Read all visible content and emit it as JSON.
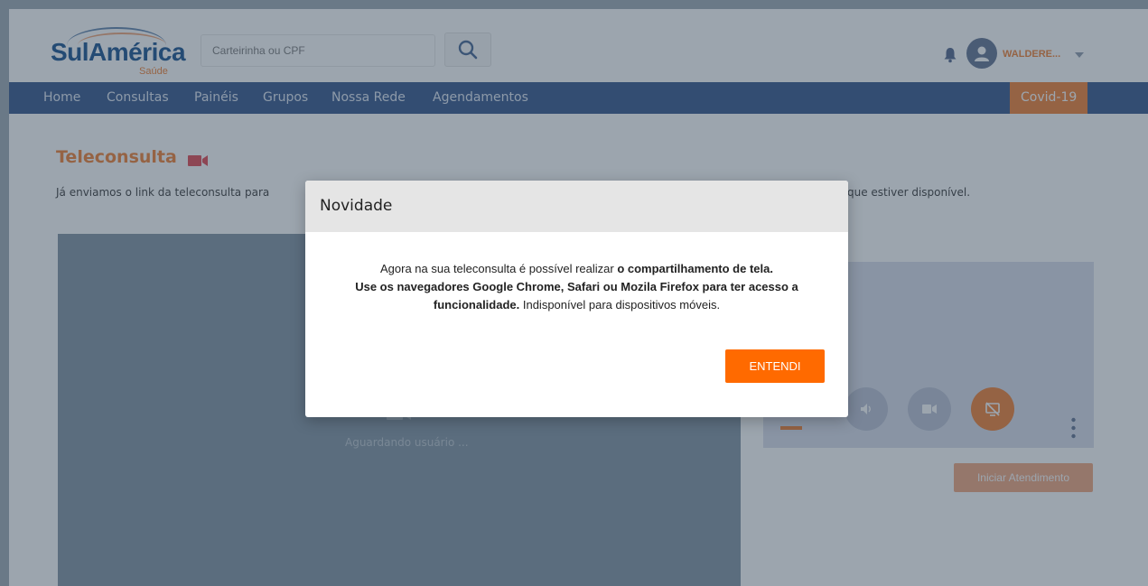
{
  "brand": {
    "name": "SulAmérica",
    "sub": "Saúde",
    "color_primary": "#0f4a8a",
    "color_accent": "#f07a2a"
  },
  "search": {
    "placeholder": "Carteirinha ou CPF",
    "icon": "search-icon"
  },
  "user": {
    "name": "WALDERE...",
    "icons": [
      "bell-icon",
      "user-avatar-icon",
      "caret-down-icon"
    ]
  },
  "nav": {
    "items": [
      {
        "label": "Home"
      },
      {
        "label": "Consultas"
      },
      {
        "label": "Painéis"
      },
      {
        "label": "Grupos"
      },
      {
        "label": "Nossa Rede"
      },
      {
        "label": "Agendamentos"
      }
    ],
    "covid_label": "Covid-19"
  },
  "teleconsulta": {
    "title": "Teleconsulta",
    "desc_left": "Já enviamos o link da teleconsulta para",
    "desc_right": "que estiver disponível.",
    "waiting": "Aguardando usuário ...",
    "start_label": "Iniciar Atendimento",
    "controls": [
      "volume-icon",
      "camera-icon",
      "screen-share-off-icon"
    ]
  },
  "modal": {
    "title": "Novidade",
    "line1_plain": "Agora na sua teleconsulta é possível realizar ",
    "line1_bold": "o compartilhamento de tela.",
    "line2_bold": "Use os navegadores Google Chrome, Safari ou Mozila Firefox para ter acesso a",
    "line3_bold": "funcionalidade.",
    "line3_plain": " Indisponível para dispositivos móveis.",
    "button_label": "ENTENDI",
    "button_color": "#ff6a00"
  }
}
